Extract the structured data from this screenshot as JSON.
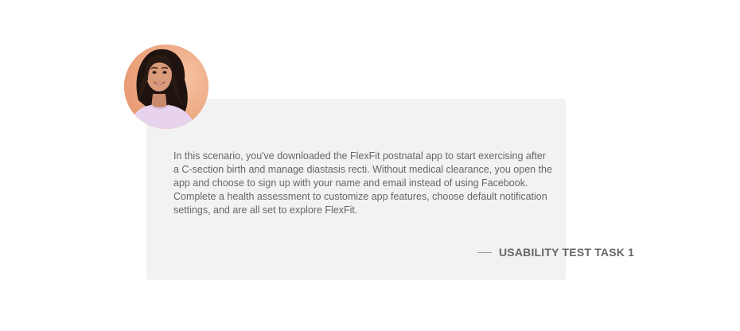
{
  "persona": {
    "avatar_icon": "woman-portrait-photo",
    "avatar_background": "#efae8a"
  },
  "scenario": {
    "text": "In this scenario, you've downloaded the FlexFit postnatal app to start exercising after a C-section birth and manage diastasis recti. Without medical clearance, you open the app and choose to sign up with your name and email instead of using Facebook.  Complete a health assessment to customize app features, choose default notification settings, and are all set to explore FlexFit."
  },
  "task": {
    "label": "USABILITY TEST TASK 1"
  },
  "colors": {
    "card_background": "#f2f2f2",
    "text": "#666666",
    "page_background": "#ffffff"
  }
}
